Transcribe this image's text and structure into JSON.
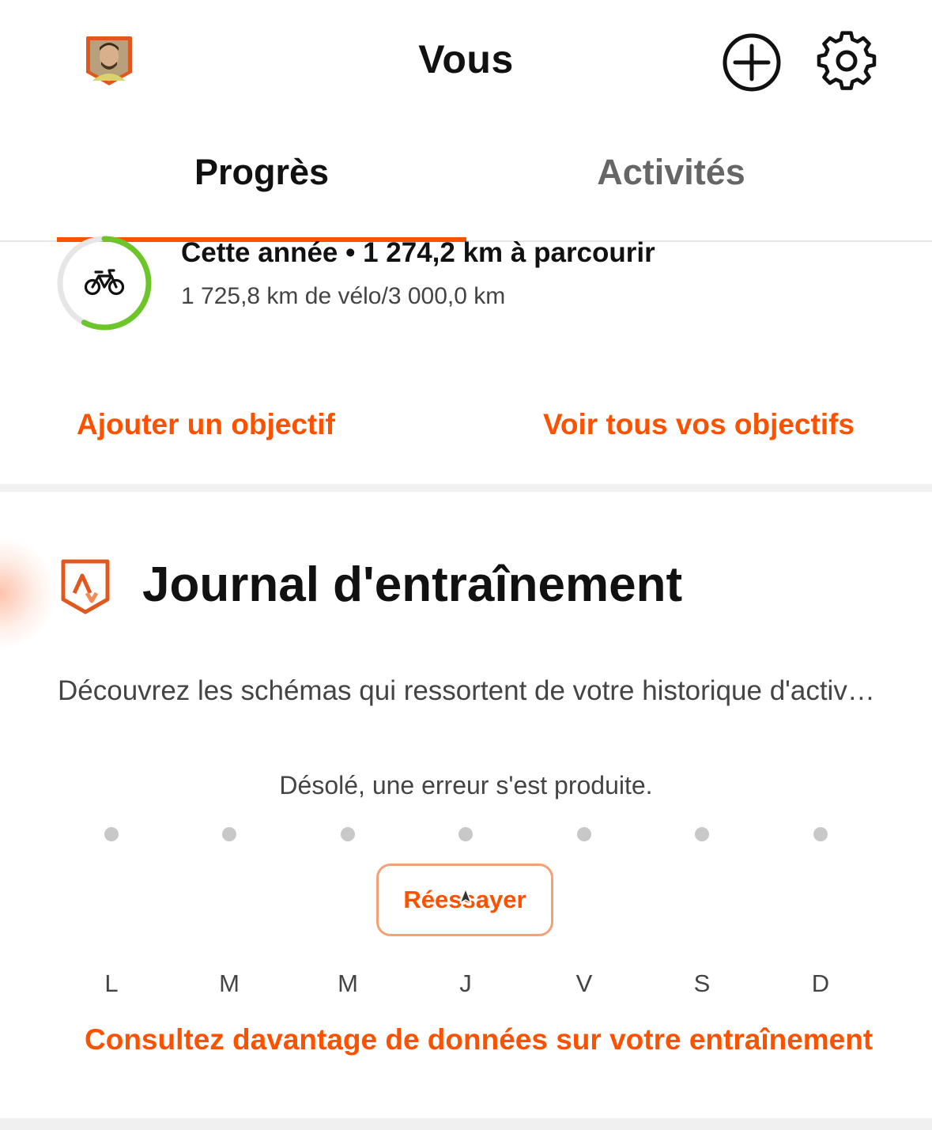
{
  "header": {
    "title": "Vous",
    "avatar_icon": "avatar-shield",
    "add_icon": "plus-circle-icon",
    "settings_icon": "gear-icon"
  },
  "tabs": [
    {
      "label": "Progrès",
      "active": true
    },
    {
      "label": "Activités",
      "active": false
    }
  ],
  "goal": {
    "sport_icon": "bike-icon",
    "line1": "Cette année • 1 274,2 km à parcourir",
    "line2": "1 725,8 km de vélo/3 000,0 km",
    "progress_fraction": 0.575,
    "progress_color": "#6cc62a"
  },
  "goal_links": {
    "add": "Ajouter un objectif",
    "view_all": "Voir tous vos objectifs"
  },
  "training_log": {
    "icon": "training-log-icon",
    "title": "Journal d'entraînement",
    "description": "Découvrez les schémas qui ressortent de votre historique d'activités",
    "error": "Désolé, une erreur s'est produite.",
    "retry_label": "Réessayer",
    "days": [
      "L",
      "M",
      "M",
      "J",
      "V",
      "S",
      "D"
    ],
    "more_link": "Consultez davantage de données sur votre entraînement"
  },
  "colors": {
    "accent": "#fc5200",
    "goal_ring": "#6cc62a"
  }
}
